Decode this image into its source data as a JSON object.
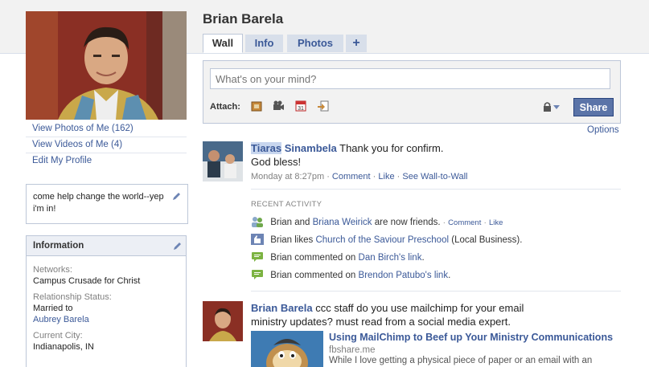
{
  "profile": {
    "name": "Brian Barela",
    "side_links": [
      "View Photos of Me (162)",
      "View Videos of Me (4)",
      "Edit My Profile"
    ],
    "status": "come help change the world--yep i'm in!"
  },
  "info": {
    "header": "Information",
    "networks_label": "Networks:",
    "networks_value": "Campus Crusade for Christ",
    "relationship_label": "Relationship Status:",
    "relationship_value": "Married to",
    "relationship_partner": "Aubrey Barela",
    "city_label": "Current City:",
    "city_value": "Indianapolis, IN"
  },
  "tabs": [
    "Wall",
    "Info",
    "Photos",
    "+"
  ],
  "publisher": {
    "placeholder": "What's on your mind?",
    "attach_label": "Attach:",
    "share_label": "Share",
    "options_label": "Options"
  },
  "story1": {
    "actor_first": "Tiaras",
    "actor_last": "Sinambela",
    "text_line1": "Thank you for confirm.",
    "text_line2": "God bless!",
    "time": "Monday at 8:27pm",
    "sep": "·",
    "comment": "Comment",
    "like": "Like",
    "wall_to_wall": "See Wall-to-Wall"
  },
  "recent": {
    "title": "RECENT ACTIVITY",
    "friends": {
      "a": "Brian and",
      "b": "Briana Weirick",
      "c": "are now friends.",
      "comment": "Comment",
      "like": "Like"
    },
    "likes": {
      "a": "Brian likes",
      "b": "Church of the Saviour Preschool",
      "c": "(Local Business)."
    },
    "comment1": {
      "a": "Brian commented on",
      "b": "Dan Birch's",
      "c": "link",
      "d": "."
    },
    "comment2": {
      "a": "Brian commented on",
      "b": "Brendon Patubo's",
      "c": "link",
      "d": "."
    }
  },
  "story2": {
    "actor": "Brian Barela",
    "text_line1": "ccc staff do you use mailchimp for your email",
    "text_line2": "ministry updates? must read from a social media expert.",
    "link_title": "Using MailChimp to Beef up Your Ministry Communications",
    "link_domain": "fbshare.me",
    "link_desc": "While I love getting a physical piece of paper or an email with an"
  },
  "colors": {
    "brand": "#3b5998",
    "share": "#5b74a8",
    "border": "#bdc7d8"
  }
}
